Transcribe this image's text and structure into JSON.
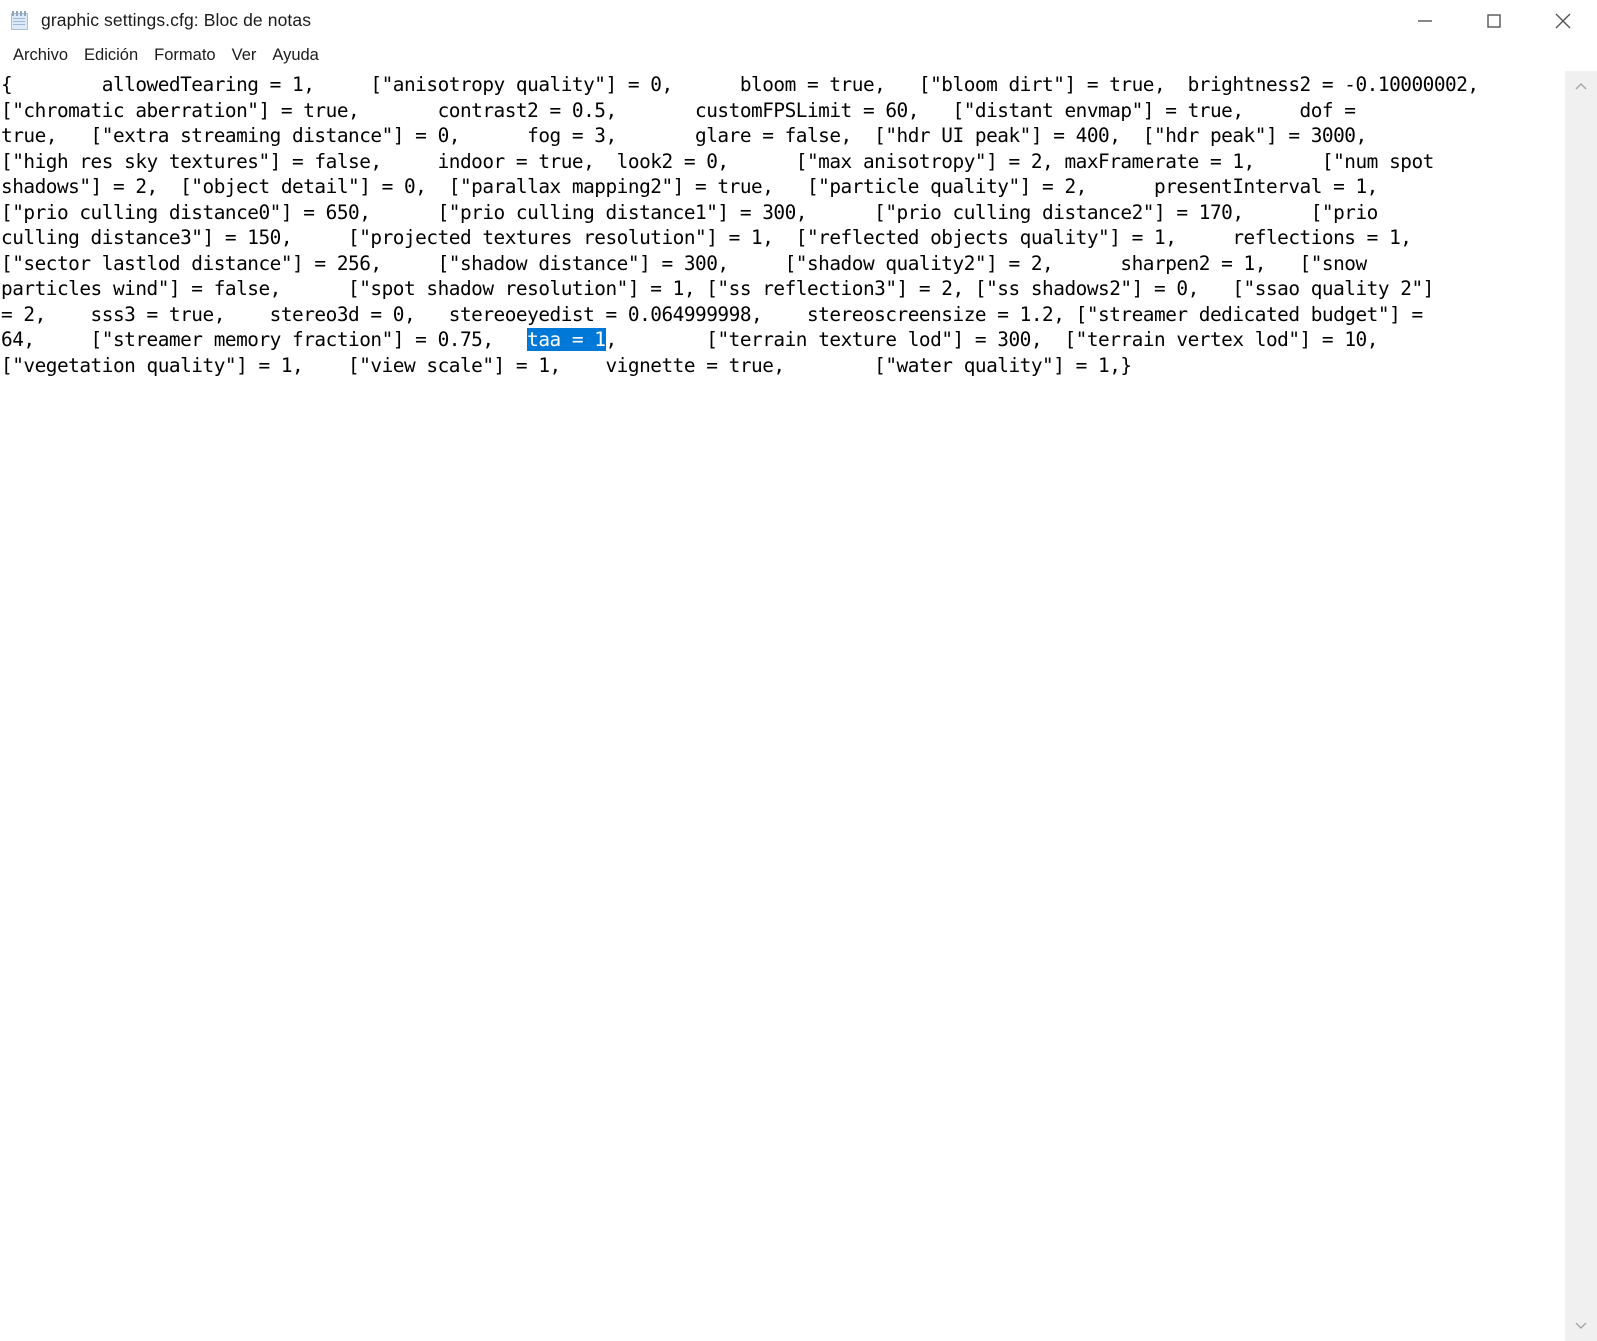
{
  "window": {
    "title": "graphic settings.cfg: Bloc de notas",
    "icon": "notepad-icon",
    "controls": {
      "minimize": "minimize-icon",
      "maximize": "maximize-icon",
      "close": "close-icon"
    }
  },
  "menubar": {
    "items": [
      {
        "label": "Archivo"
      },
      {
        "label": "Edición"
      },
      {
        "label": "Formato"
      },
      {
        "label": "Ver"
      },
      {
        "label": "Ayuda"
      }
    ]
  },
  "editor": {
    "selection_color": "#0078d7",
    "selection_text_color": "#ffffff",
    "selected_text": "taa = 1",
    "lines": [
      "{        allowedTearing = 1,     [\"anisotropy quality\"] = 0,      bloom = true,   [\"bloom dirt\"] = true,  brightness2 = -0.10000002,",
      "[\"chromatic aberration\"] = true,       contrast2 = 0.5,       customFPSLimit = 60,   [\"distant envmap\"] = true,     dof =",
      "true,   [\"extra streaming distance\"] = 0,      fog = 3,       glare = false,  [\"hdr UI peak\"] = 400,  [\"hdr peak\"] = 3000,",
      "[\"high res sky textures\"] = false,     indoor = true,  look2 = 0,      [\"max anisotropy\"] = 2, maxFramerate = 1,      [\"num spot",
      "shadows\"] = 2,  [\"object detail\"] = 0,  [\"parallax mapping2\"] = true,   [\"particle quality\"] = 2,      presentInterval = 1,",
      "[\"prio culling distance0\"] = 650,      [\"prio culling distance1\"] = 300,      [\"prio culling distance2\"] = 170,      [\"prio",
      "culling distance3\"] = 150,     [\"projected textures resolution\"] = 1,  [\"reflected objects quality\"] = 1,     reflections = 1,",
      "[\"sector lastlod distance\"] = 256,     [\"shadow distance\"] = 300,     [\"shadow quality2\"] = 2,      sharpen2 = 1,   [\"snow",
      "particles wind\"] = false,      [\"spot shadow resolution\"] = 1, [\"ss reflection3\"] = 2, [\"ss shadows2\"] = 0,   [\"ssao quality 2\"]",
      "= 2,    sss3 = true,    stereo3d = 0,   stereoeyedist = 0.064999998,    stereoscreensize = 1.2, [\"streamer dedicated budget\"] =",
      "64,     [\"streamer memory fraction\"] = 0.75,   ",
      "[\"vegetation quality\"] = 1,    [\"view scale\"] = 1,    vignette = true,        [\"water quality\"] = 1,}"
    ],
    "selection_line_index": 10,
    "selection_line_suffix": ",        [\"terrain texture lod\"] = 300,  [\"terrain vertex lod\"] = 10,"
  },
  "scrollbar": {
    "up_arrow": "chevron-up-icon",
    "down_arrow": "chevron-down-icon"
  }
}
